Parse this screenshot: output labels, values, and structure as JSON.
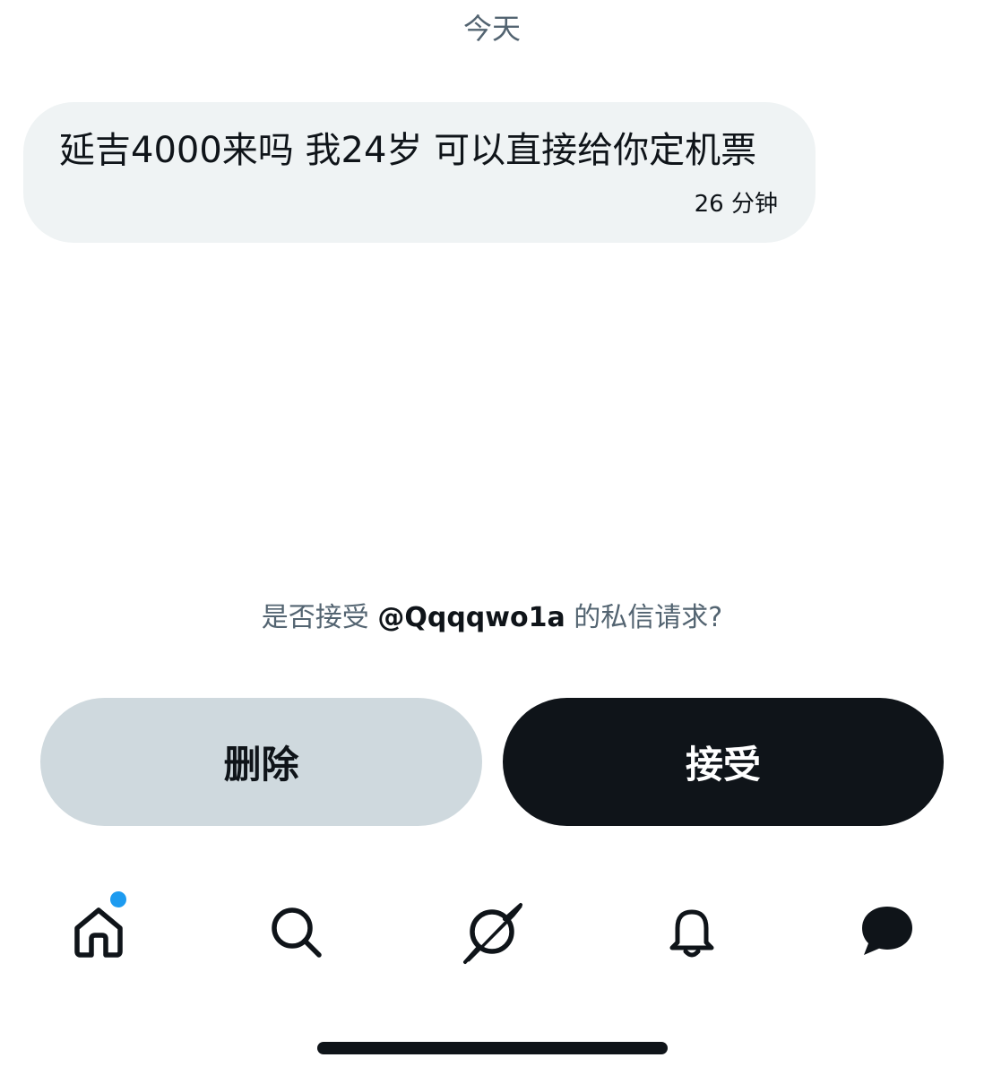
{
  "date_separator": "今天",
  "message": {
    "text": "延吉4000来吗 我24岁 可以直接给你定机票",
    "time": "26 分钟"
  },
  "request": {
    "prefix": "是否接受 ",
    "handle": "@Qqqqwo1a",
    "suffix": " 的私信请求?"
  },
  "buttons": {
    "delete_label": "删除",
    "accept_label": "接受"
  },
  "tabbar": {
    "items": [
      {
        "icon": "home-icon",
        "has_badge": true
      },
      {
        "icon": "search-icon",
        "has_badge": false
      },
      {
        "icon": "grok-icon",
        "has_badge": false
      },
      {
        "icon": "bell-icon",
        "has_badge": false
      },
      {
        "icon": "message-icon",
        "has_badge": false
      }
    ]
  },
  "colors": {
    "text_primary": "#0f1419",
    "text_secondary": "#536471",
    "bubble_bg": "#eff3f4",
    "delete_bg": "#cfd9de",
    "accept_bg": "#0f1419",
    "badge": "#1d9bf0"
  }
}
